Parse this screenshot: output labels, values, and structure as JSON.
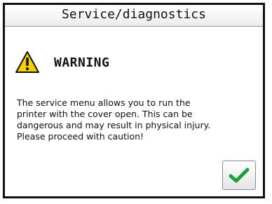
{
  "title": "Service/diagnostics",
  "warning": {
    "icon": "warning-triangle-icon",
    "label": "WARNING"
  },
  "message_lines": [
    "The service menu allows you to run the",
    "printer with the cover open. This can be",
    "dangerous and may result in physical injury.",
    "Please proceed with caution!"
  ],
  "confirm_button": {
    "icon": "checkmark-icon"
  },
  "colors": {
    "warning_yellow": "#f5d000",
    "check_green": "#1e9e3a",
    "frame": "#111111"
  }
}
